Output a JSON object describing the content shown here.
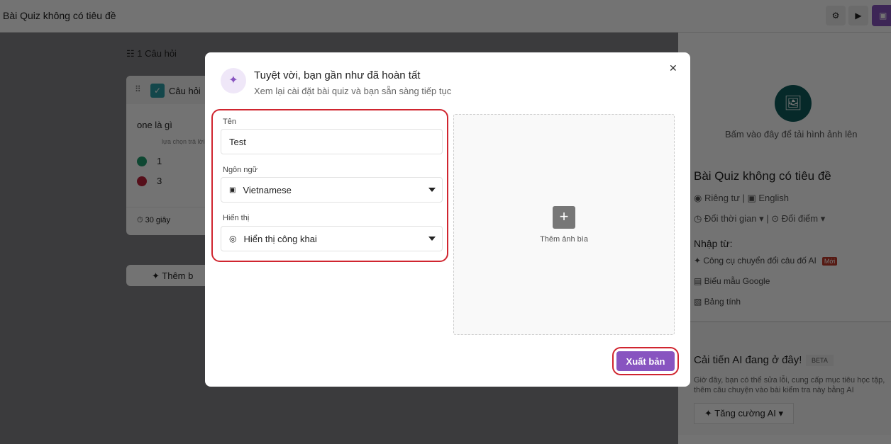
{
  "app": {
    "title": "Bài Quiz không có tiêu đề",
    "settings_icon": "gear-icon",
    "play_icon": "play-icon",
    "save_icon": "save-icon"
  },
  "editor": {
    "question_count": "1 Câu hỏi",
    "question_type": "Câu hỏi",
    "question_text": "one là gì",
    "answer_hint": "lựa chọn trả lời",
    "answers": [
      {
        "text": "1",
        "color": "#1f9e6e"
      },
      {
        "text": "3",
        "color": "#c0213a"
      }
    ],
    "time": "30 giây",
    "add_button": "Thêm b"
  },
  "panel": {
    "upload_text": "Bấm vào đây để tải hình ảnh lên",
    "quiz_title": "Bài Quiz không có tiêu đề",
    "privacy": "Riêng tư",
    "language": "English",
    "time": "Đổi thời gian",
    "points": "Đổi điểm",
    "import_title": "Nhập từ:",
    "imports": [
      {
        "label": "Công cụ chuyển đổi câu đố AI",
        "badge": "Mới"
      },
      {
        "label": "Biểu mẫu Google"
      },
      {
        "label": "Bảng tính"
      }
    ],
    "ai_title": "Cải tiến AI đang ở đây!",
    "ai_badge": "BETA",
    "ai_desc": "Giờ đây, bạn có thể sửa lỗi, cung cấp mục tiêu học tập, thêm câu chuyện vào bài kiểm tra này bằng AI",
    "ai_button": "Tăng cường AI"
  },
  "modal": {
    "title": "Tuyệt vời, bạn gần như đã hoàn tất",
    "subtitle": "Xem lại cài đặt bài quiz và bạn sẵn sàng tiếp tục",
    "name_label": "Tên",
    "name_value": "Test",
    "language_label": "Ngôn ngữ",
    "language_value": "Vietnamese",
    "visibility_label": "Hiển thị",
    "visibility_value": "Hiển thị công khai",
    "cover_label": "Thêm ảnh bìa",
    "publish": "Xuất bản",
    "accent": "#8854c0",
    "highlight": "#d0252f"
  }
}
